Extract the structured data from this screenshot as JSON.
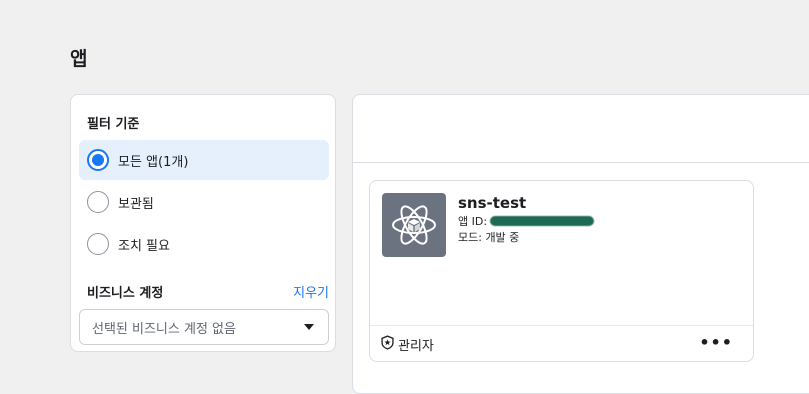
{
  "page": {
    "title": "앱"
  },
  "filter": {
    "title": "필터 기준",
    "options": [
      {
        "label": "모든 앱(1개)",
        "selected": true
      },
      {
        "label": "보관됨",
        "selected": false
      },
      {
        "label": "조치 필요",
        "selected": false
      }
    ],
    "business_label": "비즈니스 계정",
    "clear_label": "지우기",
    "business_select_value": "선택된 비즈니스 계정 없음"
  },
  "app": {
    "name": "sns-test",
    "id_label": "앱 ID:",
    "mode": "모드: 개발 중",
    "role": "관리자",
    "more": "•••",
    "icon": "atom-cube-icon"
  },
  "colors": {
    "accent": "#1877f2",
    "selected_bg": "#e6f0fd",
    "app_icon_bg": "#6b7280"
  }
}
